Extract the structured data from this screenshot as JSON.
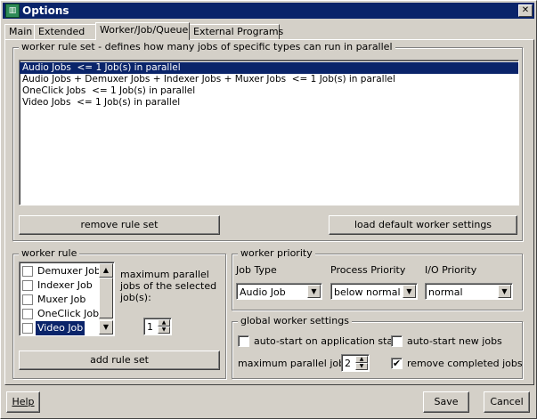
{
  "window": {
    "title": "Options",
    "icon": "app-icon",
    "close": "✕"
  },
  "tabs": [
    {
      "label": "Main"
    },
    {
      "label": "Extended"
    },
    {
      "label": "Worker/Job/Queue"
    },
    {
      "label": "External Programs"
    }
  ],
  "rule_set": {
    "legend": "worker rule set - defines how many jobs of specific types can run in parallel",
    "items": [
      "Audio Jobs  <= 1 Job(s) in parallel",
      "Audio Jobs + Demuxer Jobs + Indexer Jobs + Muxer Jobs  <= 1 Job(s) in parallel",
      "OneClick Jobs  <= 1 Job(s) in parallel",
      "Video Jobs  <= 1 Job(s) in parallel"
    ],
    "remove_button": "remove rule set",
    "load_defaults_button": "load default worker settings"
  },
  "worker_rule": {
    "legend": "worker rule",
    "items": [
      "Demuxer Job",
      "Indexer Job",
      "Muxer Job",
      "OneClick Job",
      "Video Job"
    ],
    "max_parallel_label": "maximum parallel jobs of the selected job(s):",
    "max_parallel_value": "1",
    "add_button": "add rule set"
  },
  "worker_priority": {
    "legend": "worker priority",
    "job_type_label": "Job Type",
    "process_priority_label": "Process Priority",
    "io_priority_label": "I/O Priority",
    "job_type_value": "Audio Job",
    "process_priority_value": "below normal",
    "io_priority_value": "normal"
  },
  "global_settings": {
    "legend": "global worker settings",
    "auto_start_app": "auto-start on application start",
    "auto_start_new": "auto-start new jobs",
    "max_parallel_label": "maximum parallel jobs:",
    "max_parallel_value": "2",
    "remove_completed": "remove completed jobs",
    "check_mark": "✔"
  },
  "footer": {
    "help": "Help",
    "save": "Save",
    "cancel": "Cancel"
  }
}
